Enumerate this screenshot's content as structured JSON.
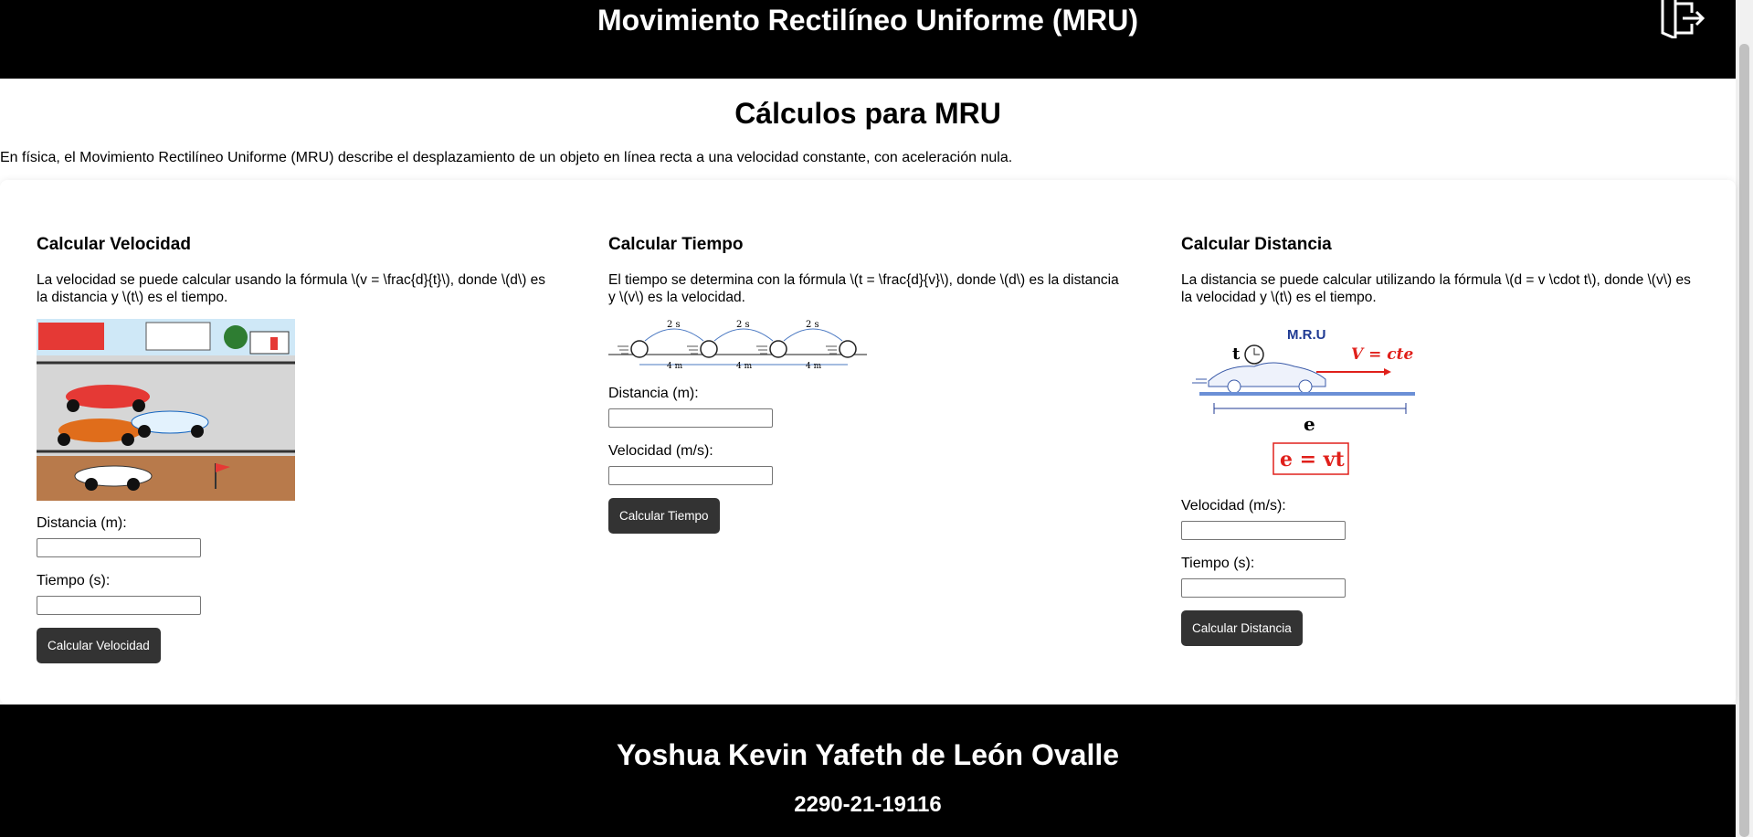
{
  "header": {
    "title": "Movimiento Rectilíneo Uniforme (MRU)"
  },
  "main": {
    "title": "Cálculos para MRU",
    "intro": "En física, el Movimiento Rectilíneo Uniforme (MRU) describe el desplazamiento de un objeto en línea recta a una velocidad constante, con aceleración nula."
  },
  "cards": [
    {
      "title": "Calcular Velocidad",
      "description": "La velocidad se puede calcular usando la fórmula \\(v = \\frac{d}{t}\\), donde \\(d\\) es la distancia y \\(t\\) es el tiempo.",
      "fields": [
        {
          "label": "Distancia (m):",
          "value": ""
        },
        {
          "label": "Tiempo (s):",
          "value": ""
        }
      ],
      "button": "Calcular Velocidad"
    },
    {
      "title": "Calcular Tiempo",
      "description": "El tiempo se determina con la fórmula \\(t = \\frac{d}{v}\\), donde \\(d\\) es la distancia y \\(v\\) es la velocidad.",
      "image_labels": {
        "interval": "2 s",
        "distance": "4 m"
      },
      "fields": [
        {
          "label": "Distancia (m):",
          "value": ""
        },
        {
          "label": "Velocidad (m/s):",
          "value": ""
        }
      ],
      "button": "Calcular Tiempo"
    },
    {
      "title": "Calcular Distancia",
      "description": "La distancia se puede calcular utilizando la fórmula \\(d = v \\cdot t\\), donde \\(v\\) es la velocidad y \\(t\\) es el tiempo.",
      "image_labels": {
        "title": "M.R.U",
        "t": "t",
        "velocity": "V = cte",
        "e": "e",
        "formula": "e = vt"
      },
      "fields": [
        {
          "label": "Velocidad (m/s):",
          "value": ""
        },
        {
          "label": "Tiempo (s):",
          "value": ""
        }
      ],
      "button": "Calcular Distancia"
    }
  ],
  "footer": {
    "author": "Yoshua Kevin Yafeth de León Ovalle",
    "code": "2290-21-19116"
  },
  "colors": {
    "header_bg": "#000000",
    "button_bg": "#333333",
    "formula_red": "#e0201b",
    "mru_blue": "#1f3a93"
  }
}
